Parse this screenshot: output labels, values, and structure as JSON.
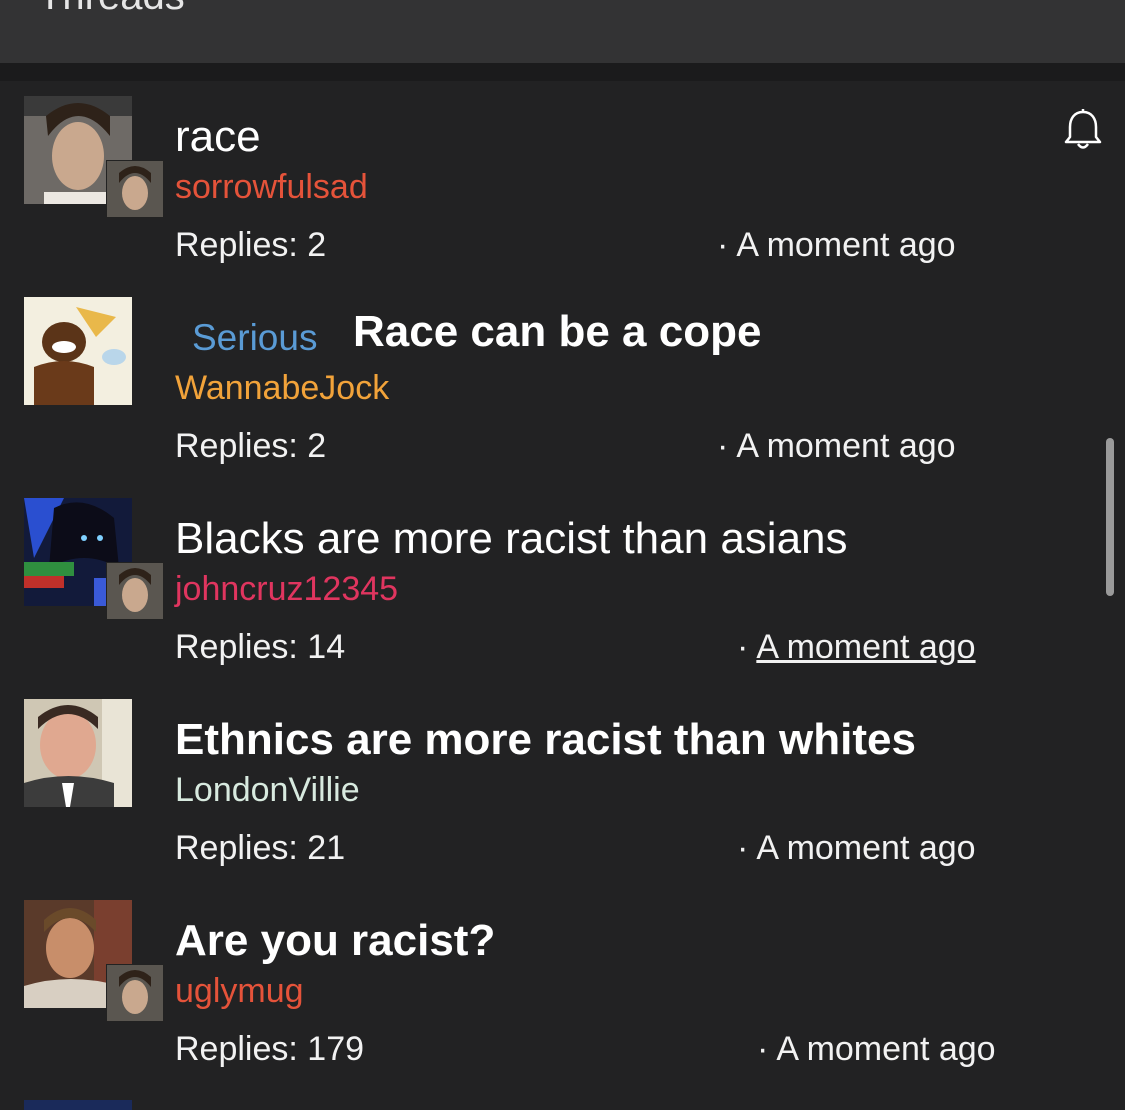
{
  "header": {
    "title": "Threads"
  },
  "threads": [
    {
      "title": "race",
      "bold": false,
      "tag": "",
      "user": "sorrowfulsad",
      "user_color": "#e5533a",
      "replies_label": "Replies: 2",
      "time": "A moment ago",
      "time_underlined": false,
      "has_mini_avatar": true
    },
    {
      "title": "Race can be a cope",
      "bold": true,
      "tag": "Serious",
      "user": "WannabeJock",
      "user_color": "#f2a33a",
      "replies_label": "Replies: 2",
      "time": "A moment ago",
      "time_underlined": false,
      "has_mini_avatar": false
    },
    {
      "title": "Blacks are more racist than asians",
      "bold": false,
      "tag": "",
      "user": "johncruz12345",
      "user_color": "#e0355f",
      "replies_label": "Replies: 14",
      "time": "A moment ago",
      "time_underlined": true,
      "has_mini_avatar": true
    },
    {
      "title": "Ethnics are more racist than whites",
      "bold": true,
      "tag": "",
      "user": "LondonVillie",
      "user_color": "#d8eadf",
      "replies_label": "Replies: 21",
      "time": "A moment ago",
      "time_underlined": false,
      "has_mini_avatar": false
    },
    {
      "title": "Are you racist?",
      "bold": true,
      "tag": "",
      "user": "uglymug",
      "user_color": "#e5533a",
      "replies_label": "Replies: 179",
      "time": "A moment ago",
      "time_underlined": false,
      "has_mini_avatar": true
    }
  ],
  "icons": {
    "bell": "bell-icon"
  }
}
